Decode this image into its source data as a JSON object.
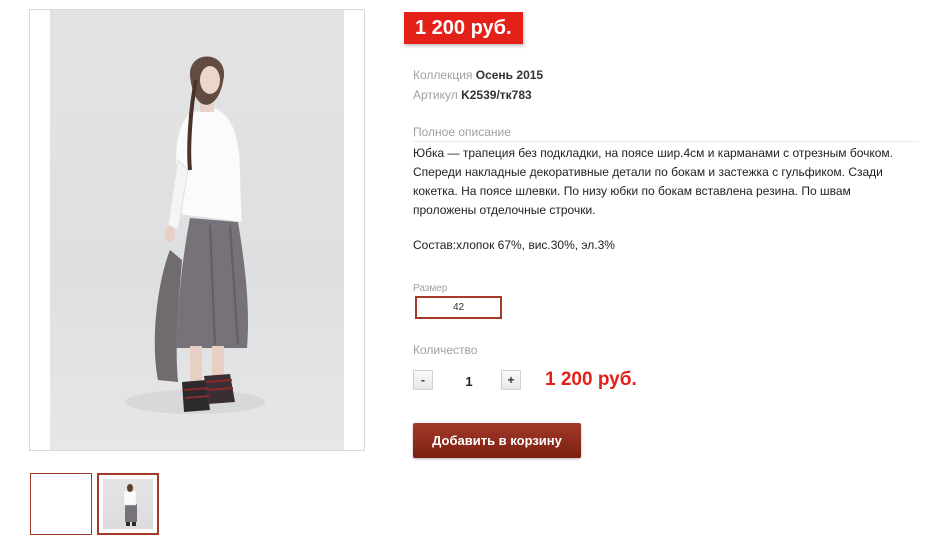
{
  "product": {
    "price_badge": "1 200 руб.",
    "collection_label": "Коллекция",
    "collection_value": "Осень 2015",
    "article_label": "Артикул",
    "article_value": "K2539/тк783",
    "description_title": "Полное описание",
    "description": "Юбка — трапеция  без подкладки, на поясе шир.4см и  карманами с отрезным бочком. Спереди накладные декоративные детали по бокам и застежка с гульфиком. Сзади кокетка. На поясе шлевки. По низу юбки по бокам вставлена резина. По швам проложены отделочные строчки.",
    "composition": "Состав:хлопок 67%, вис.30%, эл.3%",
    "size_label": "Размер",
    "size_value": "42",
    "quantity_label": "Количество",
    "quantity_minus": "-",
    "quantity_value": "1",
    "quantity_plus": "+",
    "total_price": "1 200 руб.",
    "add_to_cart": "Добавить в корзину"
  },
  "colors": {
    "price_red": "#e32119",
    "accent_brown": "#a33a2a",
    "button_dark": "#7a1f12"
  },
  "images": {
    "main": "product-photo",
    "thumbnails": [
      "blank-thumbnail",
      "product-photo-thumbnail"
    ]
  }
}
